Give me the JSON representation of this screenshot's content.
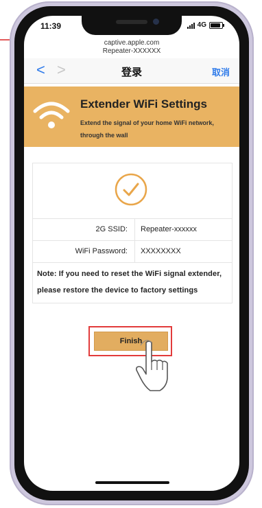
{
  "status_bar": {
    "time": "11:39",
    "network": "4G"
  },
  "browser": {
    "domain": "captive.apple.com",
    "page_name": "Repeater-XXXXXX",
    "back_symbol": "<",
    "forward_symbol": ">",
    "title": "登录",
    "cancel": "取消"
  },
  "banner": {
    "title": "Extender WiFi Settings",
    "subtitle": "Extend the signal of your home WiFi network, through the wall",
    "bg_color": "#e9b362"
  },
  "result": {
    "rows": [
      {
        "label": "2G SSID:",
        "value": "Repeater-xxxxxx"
      },
      {
        "label": "WiFi Password:",
        "value": "XXXXXXXX"
      }
    ],
    "note": "Note: If you need to reset the WiFi signal extender, please restore the device to factory settings"
  },
  "finish_button": {
    "label": "Finish"
  }
}
